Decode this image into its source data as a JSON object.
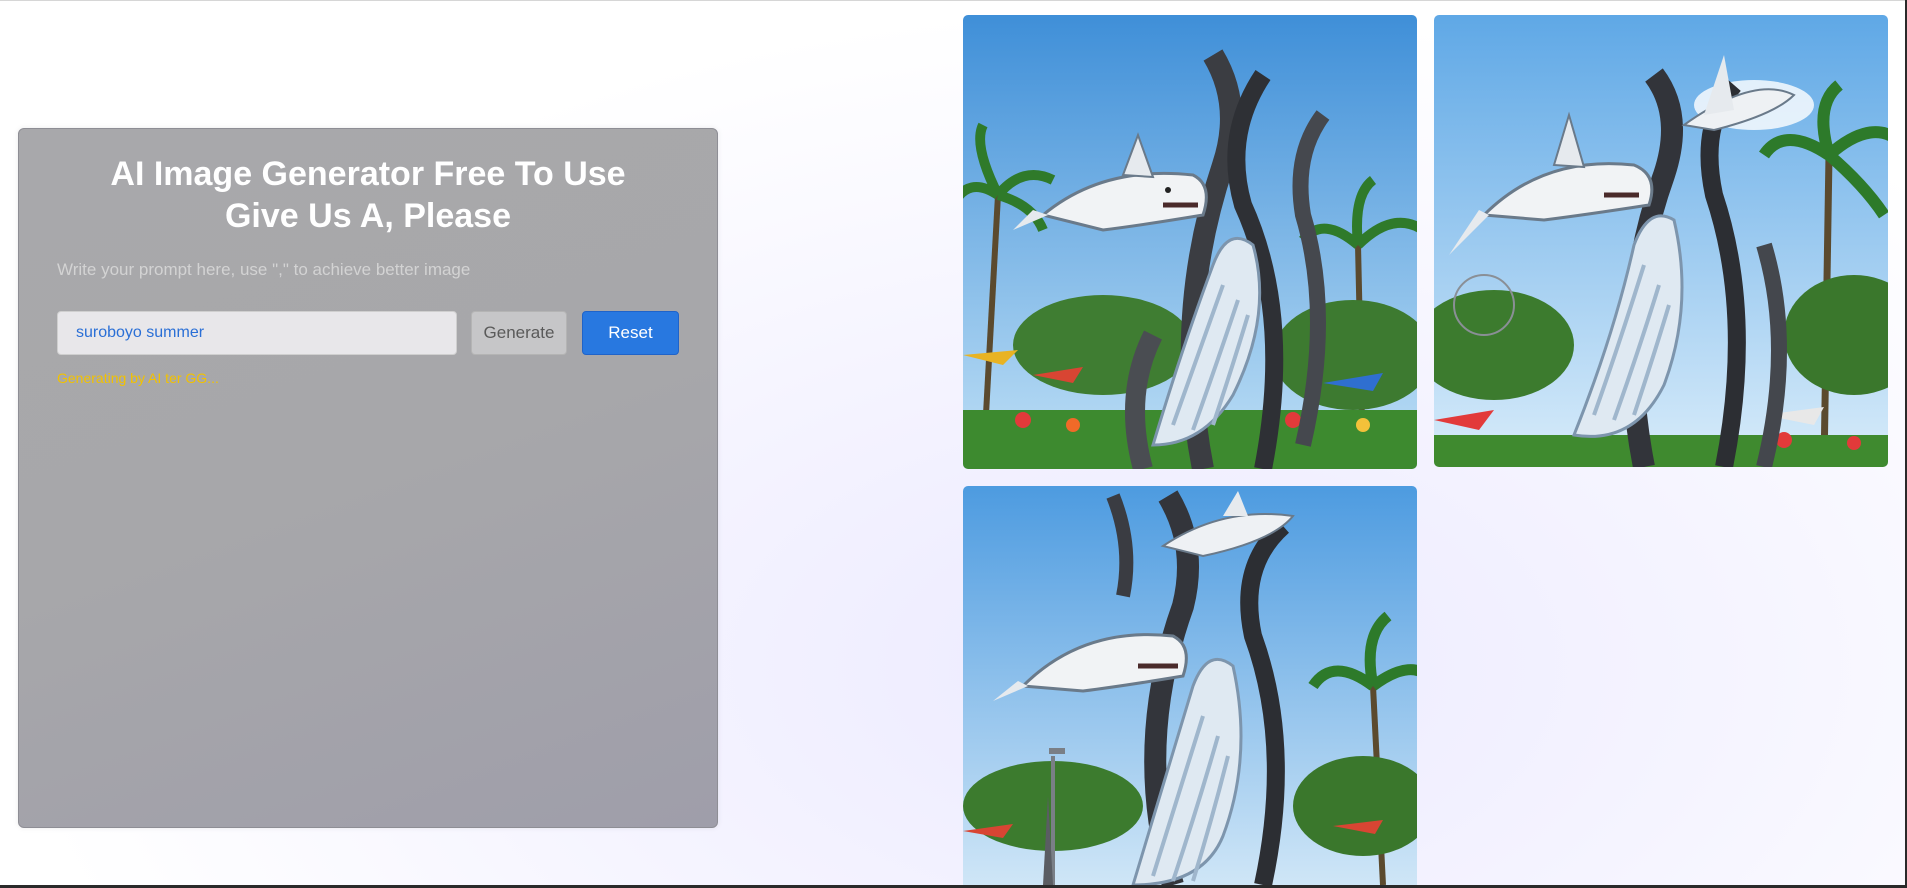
{
  "panel": {
    "title_line1": "AI Image Generator Free To Use",
    "title_line2": "Give Us A, Please",
    "hint": "Write your prompt here, use \",\" to achieve better image",
    "prompt_value": "suroboyo summer",
    "generate_label": "Generate",
    "reset_label": "Reset",
    "status": "Generating by AI ter GG..."
  },
  "gallery": {
    "images": [
      {
        "subject": "shark and crocodile statue"
      },
      {
        "subject": "shark and crocodile statue"
      },
      {
        "subject": "shark and crocodile statue"
      }
    ]
  },
  "colors": {
    "accent": "#2878e0",
    "status": "#f2c200",
    "panel": "#a8a8ab"
  }
}
